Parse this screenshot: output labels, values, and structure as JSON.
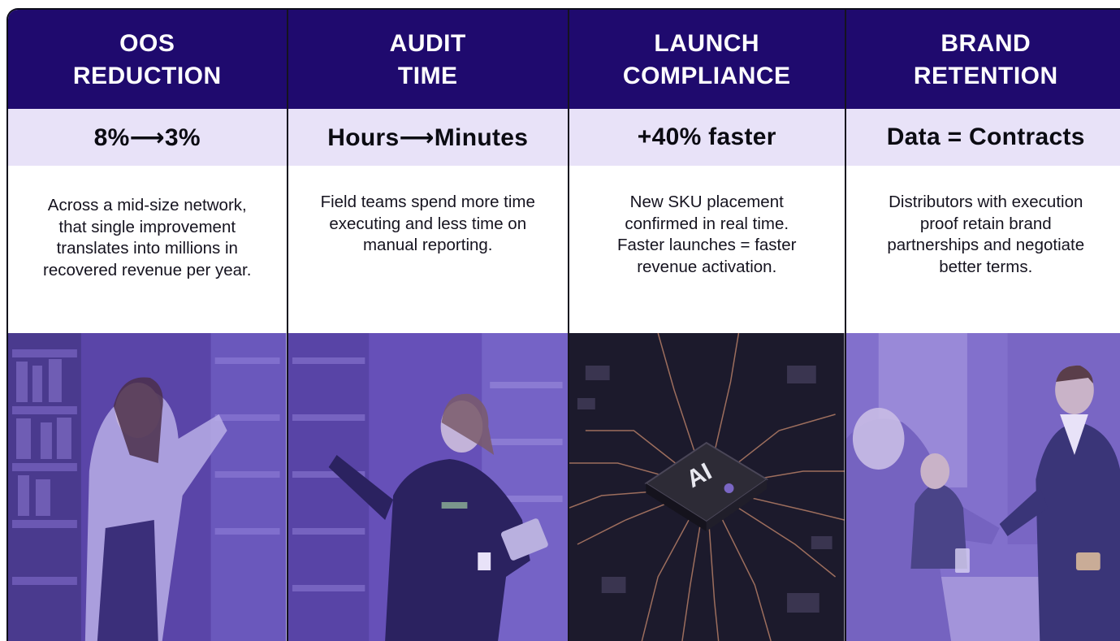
{
  "cards": [
    {
      "title_line1": "OOS",
      "title_line2": "REDUCTION",
      "metric": "8%⟶3%",
      "description": "Across a mid-size network, that single improvement translates into millions in recovered revenue per year.",
      "image_icon": "shopper-at-shelf-photo"
    },
    {
      "title_line1": "AUDIT",
      "title_line2": "TIME",
      "metric": "Hours⟶Minutes",
      "description": "Field teams spend more time executing and less time on manual reporting.",
      "image_icon": "field-worker-with-tablet-photo"
    },
    {
      "title_line1": "LAUNCH",
      "title_line2": "COMPLIANCE",
      "metric": "+40% faster",
      "description": "New SKU placement confirmed in real time. Faster launches = faster revenue activation.",
      "image_icon": "ai-chip-photo",
      "chip_label": "AI"
    },
    {
      "title_line1": "BRAND",
      "title_line2": "RETENTION",
      "metric": "Data = Contracts",
      "description": "Distributors with execution proof retain brand partnerships and negotiate better terms.",
      "image_icon": "business-handshake-photo"
    }
  ],
  "colors": {
    "header_bg": "#1f0a6e",
    "metric_bg": "#e8e2f8",
    "photo_tint": "#6a52c8"
  }
}
